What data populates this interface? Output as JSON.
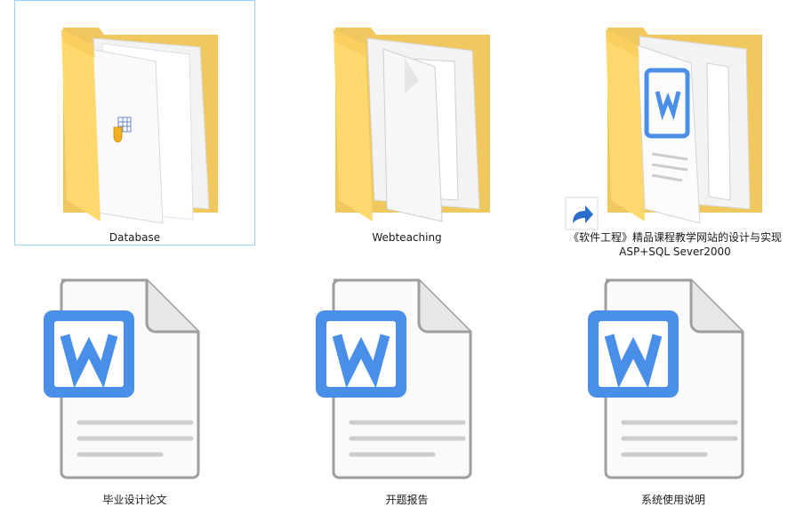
{
  "items": [
    {
      "name": "Database",
      "type": "folder",
      "selected": true,
      "badge": "database-app-icon"
    },
    {
      "name": "Webteaching",
      "type": "folder",
      "selected": false,
      "badge": ""
    },
    {
      "name_line1": "《软件工程》精品课程教学网站的设计与实现",
      "name_line2": "ASP+SQL Sever2000",
      "type": "folder-shortcut",
      "selected": false,
      "badge": "word-doc-preview"
    },
    {
      "name": "毕业设计论文",
      "type": "word-document",
      "selected": false
    },
    {
      "name": "开题报告",
      "type": "word-document",
      "selected": false
    },
    {
      "name": "系统使用说明",
      "type": "word-document",
      "selected": false
    }
  ],
  "colors": {
    "folder_back": "#f3d27a",
    "folder_front": "#ffe28e",
    "word_blue": "#4a8fe7",
    "selection_border": "#99d1ff",
    "shortcut_arrow": "#2b6ec9"
  }
}
